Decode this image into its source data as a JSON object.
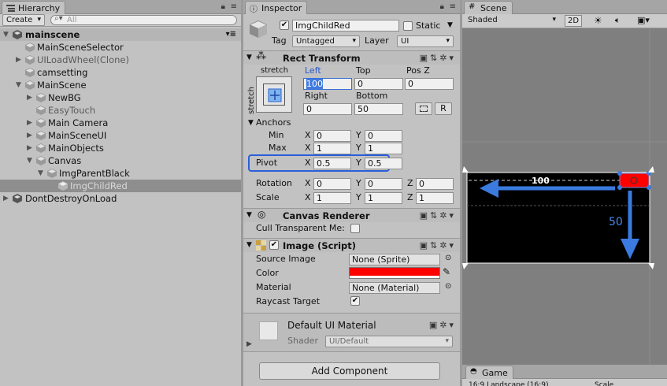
{
  "hierarchy": {
    "tab_label": "Hierarchy",
    "create_label": "Create",
    "search_placeholder": "All",
    "items": [
      {
        "label": "mainscene"
      },
      {
        "label": "MainSceneSelector"
      },
      {
        "label": "UILoadWheel(Clone)"
      },
      {
        "label": "camsetting"
      },
      {
        "label": "MainScene"
      },
      {
        "label": "NewBG"
      },
      {
        "label": "EasyTouch"
      },
      {
        "label": "Main Camera"
      },
      {
        "label": "MainSceneUI"
      },
      {
        "label": "MainObjects"
      },
      {
        "label": "Canvas"
      },
      {
        "label": "ImgParentBlack"
      },
      {
        "label": "ImgChildRed"
      },
      {
        "label": "DontDestroyOnLoad"
      }
    ]
  },
  "inspector": {
    "tab_label": "Inspector",
    "object_name": "ImgChildRed",
    "static_label": "Static",
    "tag_label": "Tag",
    "tag_value": "Untagged",
    "layer_label": "Layer",
    "layer_value": "UI",
    "rect_transform": {
      "title": "Rect Transform",
      "preset_h": "stretch",
      "preset_v": "stretch",
      "left_label": "Left",
      "left_value": "100",
      "top_label": "Top",
      "top_value": "0",
      "posz_label": "Pos Z",
      "posz_value": "0",
      "right_label": "Right",
      "right_value": "0",
      "bottom_label": "Bottom",
      "bottom_value": "50",
      "r_button": "R",
      "anchors_label": "Anchors",
      "min_label": "Min",
      "min_x": "0",
      "min_y": "0",
      "max_label": "Max",
      "max_x": "1",
      "max_y": "1",
      "pivot_label": "Pivot",
      "pivot_x": "0.5",
      "pivot_y": "0.5",
      "rotation_label": "Rotation",
      "rot_x": "0",
      "rot_y": "0",
      "rot_z": "0",
      "scale_label": "Scale",
      "scale_x": "1",
      "scale_y": "1",
      "scale_z": "1",
      "x": "X",
      "y": "Y",
      "z": "Z"
    },
    "canvas_renderer": {
      "title": "Canvas Renderer",
      "cull_label": "Cull Transparent Me:"
    },
    "image": {
      "title": "Image (Script)",
      "source_label": "Source Image",
      "source_value": "None (Sprite)",
      "color_label": "Color",
      "color_value": "#ff0000",
      "material_label": "Material",
      "material_value": "None (Material)",
      "raycast_label": "Raycast Target"
    },
    "material_asset": {
      "name": "Default UI Material",
      "shader_label": "Shader",
      "shader_value": "UI/Default"
    },
    "add_component_label": "Add Component"
  },
  "scene": {
    "tab_label": "Scene",
    "shading_value": "Shaded",
    "mode_2d": "2D",
    "offset_left_label": "100",
    "offset_bottom_label": "50",
    "game_tab_label": "Game",
    "game_resolution": "16:9 Landscape (16:9)",
    "game_scale_label": "Scale"
  },
  "colors": {
    "selection_highlight": "#2b5fd9",
    "image_color": "#ff0000",
    "arrow_blue": "#3b7be0"
  }
}
